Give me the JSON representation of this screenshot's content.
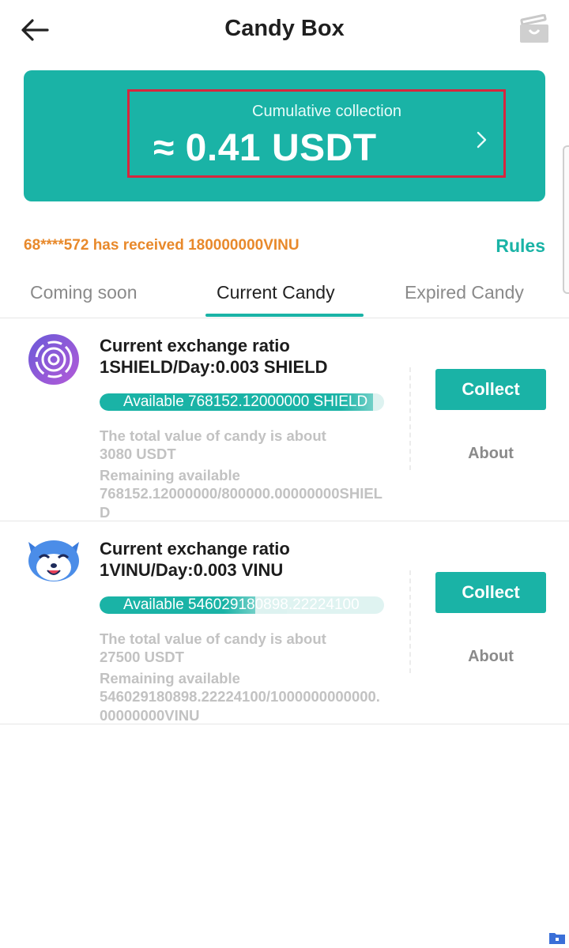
{
  "header": {
    "title": "Candy Box",
    "back_icon": "arrow-left-icon",
    "gift_icon": "gift-box-icon"
  },
  "summary": {
    "label": "Cumulative collection",
    "value": "≈ 0.41 USDT",
    "arrow_icon": "chevron-right-icon"
  },
  "notice": {
    "text": "68****572 has received 180000000VINU",
    "rules_label": "Rules"
  },
  "tabs": [
    {
      "label": "Coming soon",
      "active": false
    },
    {
      "label": "Current Candy",
      "active": true
    },
    {
      "label": "Expired Candy",
      "active": false
    }
  ],
  "candies": [
    {
      "token": "SHIELD",
      "icon": "shield-token-icon",
      "ratio_line1": "Current exchange ratio",
      "ratio_line2": "1SHIELD/Day:0.003 SHIELD",
      "available_label": "Available 768152.12000000 SHIELD",
      "available_fraction": 0.96,
      "total_value_line1": "The total value of candy is about",
      "total_value_line2": "3080 USDT",
      "remaining_label": "Remaining available",
      "remaining_value": "768152.12000000/800000.00000000SHIELD",
      "collect_label": "Collect",
      "about_label": "About"
    },
    {
      "token": "VINU",
      "icon": "vinu-token-icon",
      "ratio_line1": "Current exchange ratio",
      "ratio_line2": "1VINU/Day:0.003 VINU",
      "available_label": "Available 546029180898.22224100",
      "available_fraction": 0.546,
      "total_value_line1": "The total value of candy is about",
      "total_value_line2": "27500 USDT",
      "remaining_label": "Remaining available",
      "remaining_value": "546029180898.22224100/1000000000000.00000000VINU",
      "collect_label": "Collect",
      "about_label": "About"
    }
  ],
  "colors": {
    "accent": "#1ab3a6",
    "notice": "#e8892b",
    "highlight_border": "#d7263d"
  }
}
